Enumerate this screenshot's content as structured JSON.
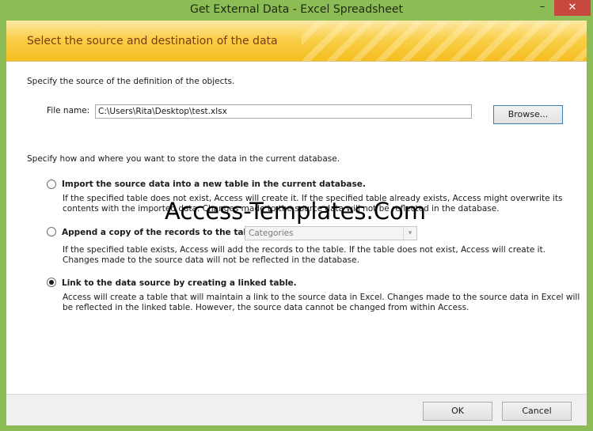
{
  "window": {
    "title": "Get External Data - Excel Spreadsheet",
    "minimize_glyph": "–",
    "close_glyph": "✕"
  },
  "banner": {
    "title": "Select the source and destination of the data"
  },
  "source": {
    "instruction": "Specify the source of the definition of the objects.",
    "file_label": "File name:",
    "file_value": "C:\\Users\\Rita\\Desktop\\test.xlsx",
    "browse_label": "Browse..."
  },
  "storage": {
    "instruction": "Specify how and where you want to store the data in the current database.",
    "options": [
      {
        "label": "Import the source data into a new table in the current database.",
        "description_1": "If the specified table does not exist, Access will create it. If the specified table already exists, Access might overwrite its",
        "description_2": "contents with the imported data. Changes made to the source data will not be reflected in the database.",
        "selected": false
      },
      {
        "label": "Append a copy of the records to the table:",
        "combo_value": "Categories",
        "description_1": "If the specified table exists, Access will add the records to the table. If the table does not exist, Access will create it.",
        "description_2": "Changes made to the source data will not be reflected in the database.",
        "selected": false
      },
      {
        "label": "Link to the data source by creating a linked table.",
        "description_1": "Access will create a table that will maintain a link to the source data in Excel. Changes made to the source data in Excel will",
        "description_2": "be reflected in the linked table. However, the source data cannot be changed from within Access.",
        "selected": true
      }
    ]
  },
  "footer": {
    "ok_label": "OK",
    "cancel_label": "Cancel"
  },
  "watermark": "Access-Templates.Com",
  "colors": {
    "window_frame": "#8cbc56",
    "banner_gold": "#f5bd1f",
    "banner_text": "#7a3c10",
    "close_button": "#c7483e"
  }
}
